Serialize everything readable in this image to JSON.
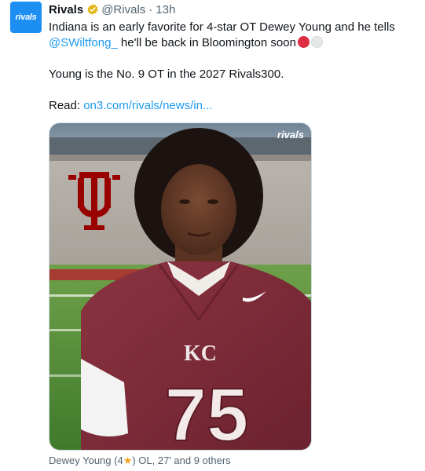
{
  "account": {
    "avatar_text": "rivals",
    "avatar_color": "#1d8ff2",
    "name": "Rivals",
    "verified_badge": "gold-verified-badge-icon",
    "handle": "@Rivals",
    "separator": "·",
    "time": "13h"
  },
  "tweet": {
    "line1_a": "Indiana is an early favorite for 4-star OT Dewey Young and he tells ",
    "mention": "@SWiltfong_",
    "line1_b": " he'll be back in Bloomington soon",
    "emoji": [
      "red-circle-icon",
      "white-circle-icon"
    ],
    "line2": "Young is the No. 9 OT in the 2027 Rivals300.",
    "read_label": "Read: ",
    "read_link": "on3.com/rivals/news/in..."
  },
  "media": {
    "watermark": "rivals",
    "jersey_number": "75",
    "jersey_monogram": "KC",
    "logo_color": "#990000"
  },
  "caption": {
    "prefix": "Dewey Young (4",
    "star": "★",
    "suffix": ") OL, 27' and 9 others"
  }
}
